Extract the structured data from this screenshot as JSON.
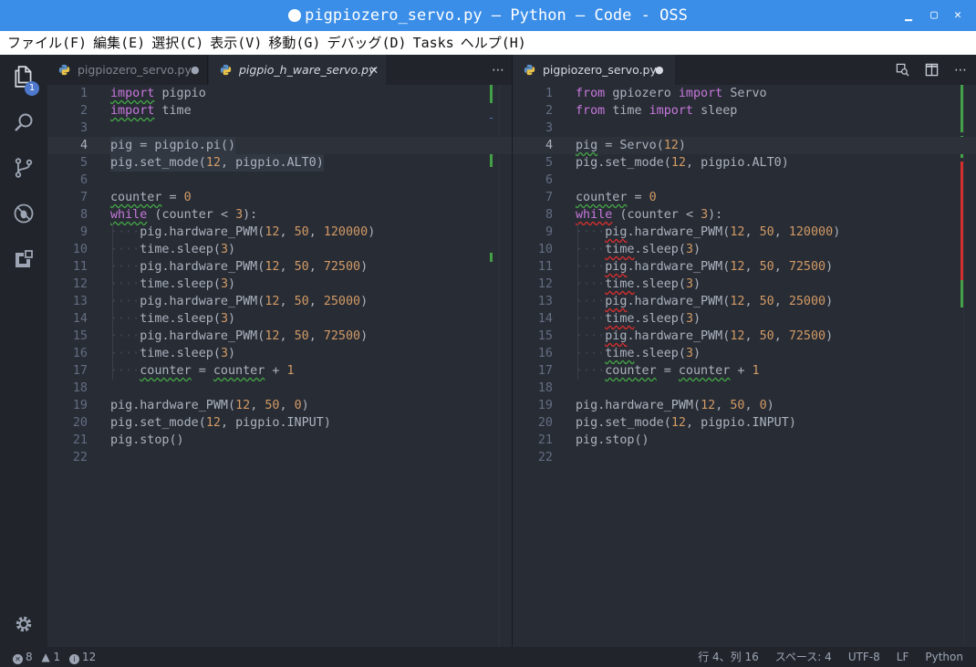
{
  "window": {
    "title": "pigpiozero_servo.py — Python — Code - OSS",
    "min_icon": "minimize-icon",
    "max_icon": "maximize-icon",
    "close_icon": "close-icon"
  },
  "menu": [
    "ファイル(F)",
    "編集(E)",
    "選択(C)",
    "表示(V)",
    "移動(G)",
    "デバッグ(D)",
    "Tasks",
    "ヘルプ(H)"
  ],
  "activity_bar": {
    "explorer_badge": "1",
    "icons": [
      "explorer-icon",
      "search-icon",
      "source-control-icon",
      "debug-icon",
      "extensions-icon",
      "settings-gear-icon"
    ]
  },
  "left_group": {
    "tabs": [
      {
        "label": "pigpiozero_servo.py",
        "state": "●"
      },
      {
        "label": "pigpio_h_ware_servo.py",
        "state": "✕"
      }
    ],
    "more_label": "⋯",
    "current_line": "4",
    "lines": [
      "import pigpio",
      "import time",
      "",
      "pig = pigpio.pi()",
      "pig.set_mode(12, pigpio.ALT0)",
      "",
      "counter = 0",
      "while (counter < 3):",
      "    pig.hardware_PWM(12, 50, 120000)",
      "    time.sleep(3)",
      "    pig.hardware_PWM(12, 50, 72500)",
      "    time.sleep(3)",
      "    pig.hardware_PWM(12, 50, 25000)",
      "    time.sleep(3)",
      "    pig.hardware_PWM(12, 50, 72500)",
      "    time.sleep(3)",
      "    counter = counter + 1",
      "",
      "pig.hardware_PWM(12, 50, 0)",
      "pig.set_mode(12, pigpio.INPUT)",
      "pig.stop()",
      ""
    ]
  },
  "right_group": {
    "tabs": [
      {
        "label": "pigpiozero_servo.py",
        "state": "●"
      }
    ],
    "actions": [
      "open-changes-icon",
      "split-editor-icon"
    ],
    "more_label": "⋯",
    "current_line": "4",
    "lines": [
      "from gpiozero import Servo",
      "from time import sleep",
      "",
      "pig = Servo(12)",
      "pig.set_mode(12, pigpio.ALT0)",
      "",
      "counter = 0",
      "while (counter < 3):",
      "    pig.hardware_PWM(12, 50, 120000)",
      "    time.sleep(3)",
      "    pig.hardware_PWM(12, 50, 72500)",
      "    time.sleep(3)",
      "    pig.hardware_PWM(12, 50, 25000)",
      "    time.sleep(3)",
      "    pig.hardware_PWM(12, 50, 72500)",
      "    time.sleep(3)",
      "    counter = counter + 1",
      "",
      "pig.hardware_PWM(12, 50, 0)",
      "pig.set_mode(12, pigpio.INPUT)",
      "pig.stop()",
      ""
    ]
  },
  "status": {
    "errors": "8",
    "warnings": "1",
    "infos": "12",
    "position": "行 4、列 16",
    "indent": "スペース: 4",
    "encoding": "UTF-8",
    "eol": "LF",
    "language": "Python"
  },
  "colors": {
    "titlebar": "#3b8ee8",
    "editor_bg": "#282c34",
    "keyword": "#c678dd",
    "number": "#d19a66",
    "error": "#d32f2f",
    "warning": "#43a047"
  }
}
